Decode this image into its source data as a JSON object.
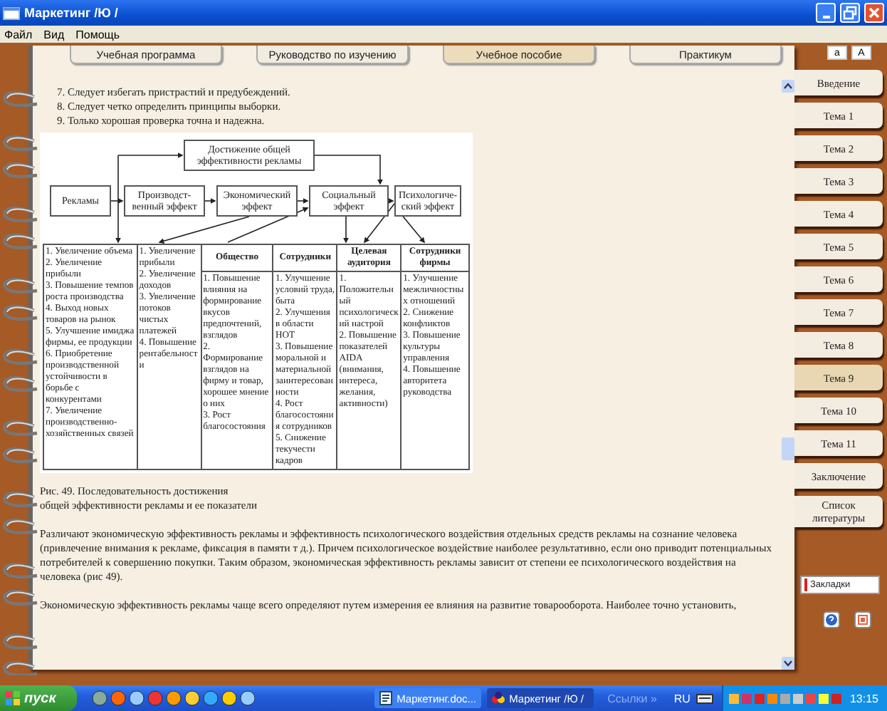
{
  "window": {
    "title": "Маркетинг /Ю /"
  },
  "menu": [
    "Файл",
    "Вид",
    "Помощь"
  ],
  "top_tabs": [
    {
      "label": "Учебная программа",
      "selected": false
    },
    {
      "label": "Руководство по изучению",
      "selected": false
    },
    {
      "label": "Учебное пособие",
      "selected": true
    },
    {
      "label": "Практикум",
      "selected": false
    }
  ],
  "font_buttons": [
    "a",
    "A"
  ],
  "content": {
    "list_lines": [
      "7. Следует избегать пристрастий и предубеждений.",
      "8. Следует четко определить принципы выборки.",
      "9. Только хорошая проверка точна и надежна."
    ],
    "diagram": {
      "goal": "Достижение общей эффективности рекламы",
      "boxes": [
        "Рекламы",
        "Производст-венный эффект",
        "Экономический эффект",
        "Социальный эффект",
        "Психологиче-ский эффект"
      ],
      "columns": [
        {
          "items": [
            "1. Увеличение объема",
            "2. Увеличение прибыли",
            "3. Повышение темпов роста производства",
            "4. Выход новых товаров на рынок",
            "5. Улучшение имиджа фирмы, ее продукции",
            "6. Приобретение производственной устойчивости в борьбе с конкурентами",
            "7. Увеличение производственно-хозяйственных связей"
          ]
        },
        {
          "items": [
            "1. Увеличение прибыли",
            "2. Увеличение доходов",
            "3. Увеличение потоков чистых платежей",
            "4. Повышение рентабельности"
          ]
        },
        {
          "header": "Общество",
          "items": [
            "1. Повышение влияния на формирование вкусов предпочтений, взглядов",
            "2. Формирование взглядов на фирму и товар, хорошее мнение о них",
            "3. Рост благосостояния"
          ]
        },
        {
          "header": "Сотрудники",
          "items": [
            "1. Улучшение условий труда, быта",
            "2. Улучшения в области НОТ",
            "3. Повышение моральной и материальной заинтересованности",
            "4. Рост благосостояния сотрудников",
            "5. Снижение текучести кадров"
          ]
        },
        {
          "header": "Целевая аудитория",
          "items": [
            "1. Положительный психологический настрой",
            "2. Повышение показателей AIDA (внимания, интереса, желания, активности)"
          ]
        },
        {
          "header": "Сотрудники фирмы",
          "items": [
            "1. Улучшение межличностных отношений",
            "2. Снижение конфликтов",
            "3. Повышение культуры управления",
            "4. Повышение авторитета руководства"
          ]
        }
      ]
    },
    "caption": [
      "Рис. 49. Последовательность достижения",
      "общей эффективности рекламы и ее показатели"
    ],
    "paragraphs": [
      "Различают экономическую эффективность рекламы и эффективность психологического воздействия отдельных средств рекламы на сознание человека (привлечение внимания к рекламе, фиксация в памяти т д.). Причем психологическое воздействие наиболее результативно, если оно приводит потенциальных потребителей к совершению покупки. Таким образом, экономическая эффективность рекламы зависит от степени ее психологического воздействия на человека (рис 49).",
      "Экономическую эффективность рекламы чаще всего определяют путем измерения ее влияния на развитие товарооборота. Наиболее точно установить,"
    ]
  },
  "sidebar": {
    "items": [
      {
        "label": "Введение",
        "selected": false
      },
      {
        "label": "Тема 1",
        "selected": false
      },
      {
        "label": "Тема 2",
        "selected": false
      },
      {
        "label": "Тема 3",
        "selected": false
      },
      {
        "label": "Тема 4",
        "selected": false
      },
      {
        "label": "Тема 5",
        "selected": false
      },
      {
        "label": "Тема 6",
        "selected": false
      },
      {
        "label": "Тема 7",
        "selected": false
      },
      {
        "label": "Тема 8",
        "selected": false
      },
      {
        "label": "Тема 9",
        "selected": true
      },
      {
        "label": "Тема 10",
        "selected": false
      },
      {
        "label": "Тема 11",
        "selected": false
      },
      {
        "label": "Заключение",
        "selected": false
      },
      {
        "label": "Список литературы",
        "selected": false
      }
    ],
    "bookmarks_button": "Закладки"
  },
  "taskbar": {
    "start": "пуск",
    "tasks": [
      {
        "label": "Маркетинг.doc...",
        "kind": "document",
        "selected": false
      },
      {
        "label": "Маркетинг /Ю /",
        "kind": "app",
        "selected": true
      }
    ],
    "links": "Ссылки",
    "links_arrow": "»",
    "language": "RU",
    "clock": "13:15"
  }
}
